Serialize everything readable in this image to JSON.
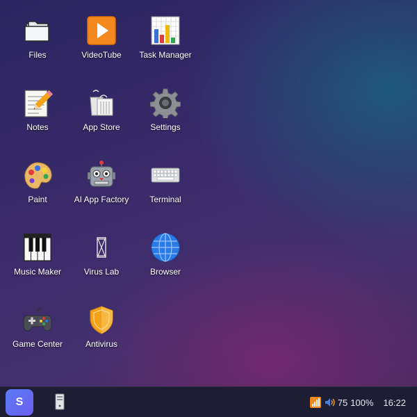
{
  "desktop": {
    "icons": [
      {
        "label": "Files",
        "icon": "folder-icon"
      },
      {
        "label": "VideoTube",
        "icon": "play-icon"
      },
      {
        "label": "Task Manager",
        "icon": "bar-chart-icon"
      },
      {
        "label": "Notes",
        "icon": "notepad-icon"
      },
      {
        "label": "App Store",
        "icon": "shopping-bags-icon"
      },
      {
        "label": "Settings",
        "icon": "gear-icon"
      },
      {
        "label": "Paint",
        "icon": "palette-icon"
      },
      {
        "label": "AI App Factory",
        "icon": "robot-icon"
      },
      {
        "label": "Terminal",
        "icon": "keyboard-icon"
      },
      {
        "label": "Music Maker",
        "icon": "piano-icon"
      },
      {
        "label": "Virus Lab",
        "icon": "hourglass-icon"
      },
      {
        "label": "Browser",
        "icon": "globe-icon"
      },
      {
        "label": "Game Center",
        "icon": "gamepad-icon"
      },
      {
        "label": "Antivirus",
        "icon": "shield-icon"
      }
    ]
  },
  "taskbar": {
    "start_label": "S",
    "open_window_icon": "computer-tower-icon",
    "volume": "75",
    "battery": "100%",
    "clock": "16:22"
  },
  "colors": {
    "taskbar_bg": "#1d1d33",
    "start_accent": "#5b7cf5"
  }
}
